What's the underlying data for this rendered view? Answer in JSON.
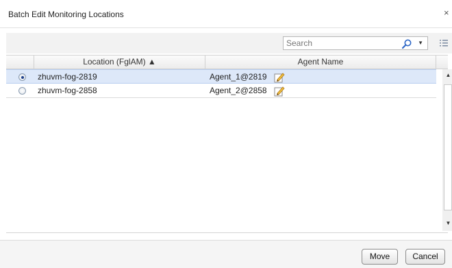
{
  "dialog": {
    "title": "Batch Edit Monitoring Locations",
    "close_glyph": "×"
  },
  "toolbar": {
    "search_placeholder": "Search",
    "search_icon": "search-icon",
    "dropdown_icon": "chevron-down-icon",
    "column_options_icon": "column-options-icon"
  },
  "table": {
    "columns": [
      "Location (FglAM) ▲",
      "Agent Name"
    ],
    "sort": {
      "column": "Location (FglAM)",
      "direction": "ascending"
    },
    "rows": [
      {
        "location": "zhuvm-fog-2819",
        "agent": "Agent_1@2819",
        "selected": true
      },
      {
        "location": "zhuvm-fog-2858",
        "agent": "Agent_2@2858",
        "selected": false
      }
    ]
  },
  "scrollbar": {
    "up_glyph": "▲",
    "down_glyph": "▼"
  },
  "buttons": {
    "move": "Move",
    "cancel": "Cancel"
  },
  "colors": {
    "selected_row": "#dde8f9",
    "radio_dot": "#1c3f8a"
  }
}
